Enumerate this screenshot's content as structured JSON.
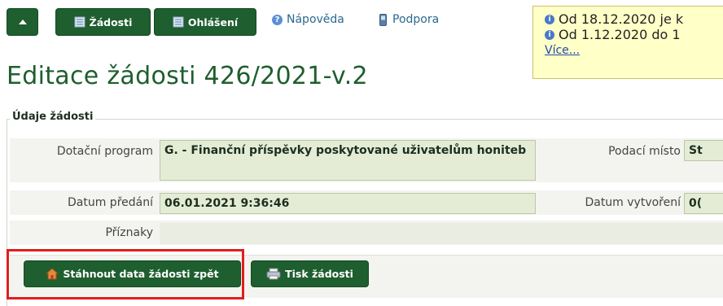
{
  "toolbar": {
    "zadosti_label": "Žádosti",
    "ohlaseni_label": "Ohlášení",
    "help_label": "Nápověda",
    "support_label": "Podpora"
  },
  "notice": {
    "line1": "Od 18.12.2020 je k",
    "line2": "Od 1.12.2020 do 1",
    "more": "Více..."
  },
  "page": {
    "title": "Editace žádosti 426/2021-v.2"
  },
  "section": {
    "legend": "Údaje žádosti",
    "program_label": "Dotační program",
    "program_value": "G. - Finanční příspěvky poskytované uživatelům honiteb",
    "podaci_label": "Podací místo",
    "podaci_value": "St",
    "predani_label": "Datum předání",
    "predani_value": "06.01.2021 9:36:46",
    "vytvoreni_label": "Datum vytvoření",
    "vytvoreni_value": "0(",
    "priznaky_label": "Příznaky"
  },
  "actions": {
    "download_label": "Stáhnout data žádosti zpět",
    "print_label": "Tisk žádosti"
  },
  "colors": {
    "button_green": "#1e5e2f",
    "highlight_red": "#e01e1e",
    "notice_bg": "#ffffc8"
  }
}
